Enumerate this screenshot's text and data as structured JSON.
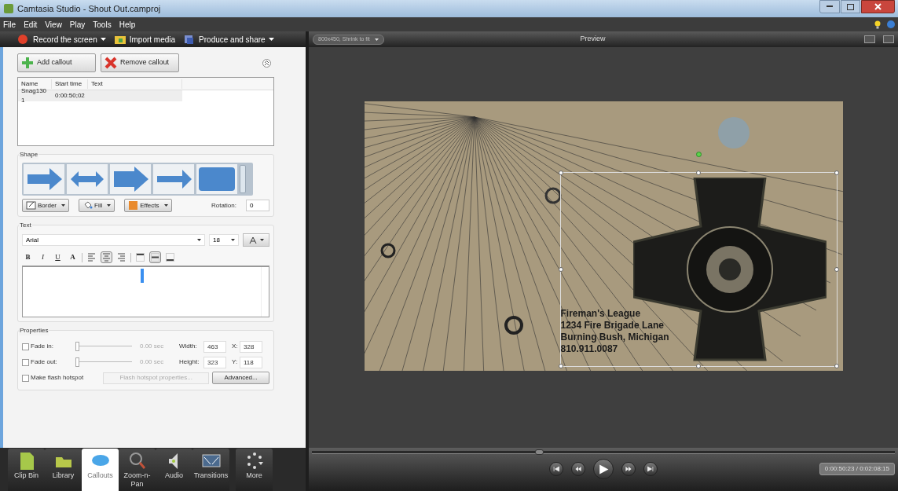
{
  "window": {
    "title": "Camtasia Studio - Shout Out.camproj"
  },
  "menu": [
    "File",
    "Edit",
    "View",
    "Play",
    "Tools",
    "Help"
  ],
  "toolbar": [
    {
      "kind": "record",
      "label": "Record the screen",
      "dropdown": true
    },
    {
      "kind": "import",
      "label": "Import media",
      "dropdown": false
    },
    {
      "kind": "produce",
      "label": "Produce and share",
      "dropdown": true
    }
  ],
  "callout_buttons": [
    {
      "kind": "add",
      "label": "Add callout"
    },
    {
      "kind": "remove",
      "label": "Remove callout"
    }
  ],
  "callout_table": {
    "columns": [
      "Name",
      "Start time",
      "Text"
    ],
    "rows": [
      [
        "Snag130 1",
        "0:00:50;02",
        ""
      ]
    ]
  },
  "shape": {
    "title": "Shape",
    "items": [
      {
        "kind": "arrow",
        "selected": false
      },
      {
        "kind": "double-arrow",
        "selected": false
      },
      {
        "kind": "fat-arrow",
        "selected": false
      },
      {
        "kind": "thin-arrow",
        "selected": false
      },
      {
        "kind": "rounded-rect",
        "selected": false
      }
    ],
    "buttons": [
      {
        "kind": "border",
        "label": "Border"
      },
      {
        "kind": "fill",
        "label": "Fill"
      },
      {
        "kind": "effects",
        "label": "Effects"
      }
    ],
    "rotation_label": "Rotation:",
    "rotation": "0"
  },
  "text": {
    "title": "Text",
    "font": "Arial",
    "size": "18",
    "format": [
      {
        "kind": "bold",
        "label": "B",
        "selected": false
      },
      {
        "kind": "italic",
        "label": "I",
        "selected": false
      },
      {
        "kind": "underline",
        "label": "U",
        "selected": false
      },
      {
        "kind": "color",
        "label": "A",
        "selected": false
      },
      {
        "kind": "align-left",
        "selected": false
      },
      {
        "kind": "align-center",
        "selected": true
      },
      {
        "kind": "align-right",
        "selected": false
      },
      {
        "kind": "valign-top",
        "selected": false
      },
      {
        "kind": "valign-middle",
        "selected": true
      },
      {
        "kind": "valign-bottom",
        "selected": false
      }
    ]
  },
  "properties": {
    "title": "Properties",
    "fades": [
      {
        "label": "Fade in:",
        "checked": false,
        "level": 0,
        "reading": "0.00 sec"
      },
      {
        "label": "Fade out:",
        "checked": false,
        "level": 0,
        "reading": "0.00 sec"
      }
    ],
    "fields": [
      {
        "label": "Width:",
        "value": "463"
      },
      {
        "label": "X:",
        "value": "328"
      },
      {
        "label": "Height:",
        "value": "323"
      },
      {
        "label": "Y:",
        "value": "118"
      }
    ],
    "hotspot": {
      "label": "Make flash hotspot",
      "checked": false
    },
    "hotspot_button": {
      "label": "Flash hotspot properties...",
      "disabled": true
    },
    "advanced_button": {
      "label": "Advanced..."
    }
  },
  "bottom_tabs": [
    {
      "kind": "clip-bin",
      "label": "Clip Bin",
      "selected": false
    },
    {
      "kind": "library",
      "label": "Library",
      "selected": false
    },
    {
      "kind": "callouts",
      "label": "Callouts",
      "selected": true
    },
    {
      "kind": "zoom",
      "label": "Zoom-n-Pan",
      "selected": false
    },
    {
      "kind": "audio",
      "label": "Audio",
      "selected": false
    },
    {
      "kind": "transitions",
      "label": "Transitions",
      "selected": false
    },
    {
      "kind": "more",
      "label": "More",
      "selected": false
    }
  ],
  "preview": {
    "size": "800x450, Shrink to fit",
    "title": "Preview",
    "callout_lines": [
      "Fireman's League",
      "1234 Fire Brigade Lane",
      "Burning Bush, Michigan",
      "810.911.0087"
    ]
  },
  "playback": {
    "level": 0.39,
    "time": "0:00:50:23 / 0:02:08:15",
    "controls": [
      {
        "kind": "start"
      },
      {
        "kind": "rewind"
      },
      {
        "kind": "play"
      },
      {
        "kind": "forward"
      },
      {
        "kind": "end"
      }
    ]
  }
}
